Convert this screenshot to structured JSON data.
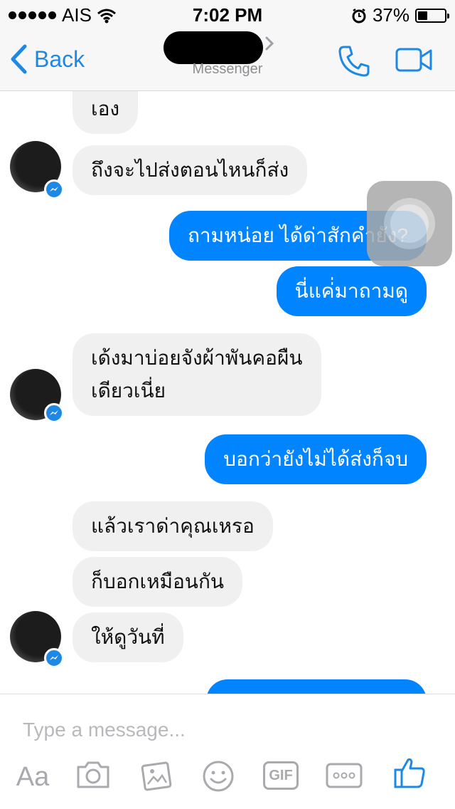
{
  "status_bar": {
    "carrier": "AIS",
    "time": "7:02 PM",
    "battery_percent": "37%",
    "battery_level": 0.37,
    "icons": [
      "signal-dots-icon",
      "wifi-icon",
      "alarm-icon",
      "battery-icon"
    ]
  },
  "header": {
    "back_label": "Back",
    "subtitle": "Messenger",
    "icons": [
      "back-chevron-icon",
      "chevron-right-icon",
      "phone-icon",
      "video-camera-icon"
    ]
  },
  "messages": [
    {
      "direction": "in",
      "text": "เอง"
    },
    {
      "direction": "in",
      "text": "ถึงจะไปส่งตอนไหนก็ส่ง"
    },
    {
      "direction": "out",
      "text": "ถามหน่อย ได้ด่าสักคำยัง?"
    },
    {
      "direction": "out",
      "text": "นี่แค่่มาถามดู"
    },
    {
      "direction": "in",
      "text": "เด้งมาบ่อยจังผ้าพันคอผืน"
    },
    {
      "direction": "in",
      "text": "เดียวเนี่ย"
    },
    {
      "direction": "out",
      "text": "บอกว่ายังไม่ได้ส่งก็จบ"
    },
    {
      "direction": "in",
      "text": "แล้วเราด่าคุณเหรอ"
    },
    {
      "direction": "in",
      "text": "ก็บอกเหมือนกัน"
    },
    {
      "direction": "in",
      "text": "ให้ดูวันที่"
    },
    {
      "direction": "out",
      "text": ""
    }
  ],
  "composer": {
    "placeholder": "Type a message...",
    "aa_label": "Aa",
    "gif_label": "GIF",
    "icons": [
      "camera-icon",
      "photo-gallery-icon",
      "emoji-icon",
      "gif-icon",
      "more-icon",
      "thumbs-up-icon"
    ]
  },
  "colors": {
    "accent": "#1e88e5",
    "outgoing_bubble": "#0084ff",
    "incoming_bubble": "#f0f0f0",
    "bar_background": "#f7f7f8"
  }
}
